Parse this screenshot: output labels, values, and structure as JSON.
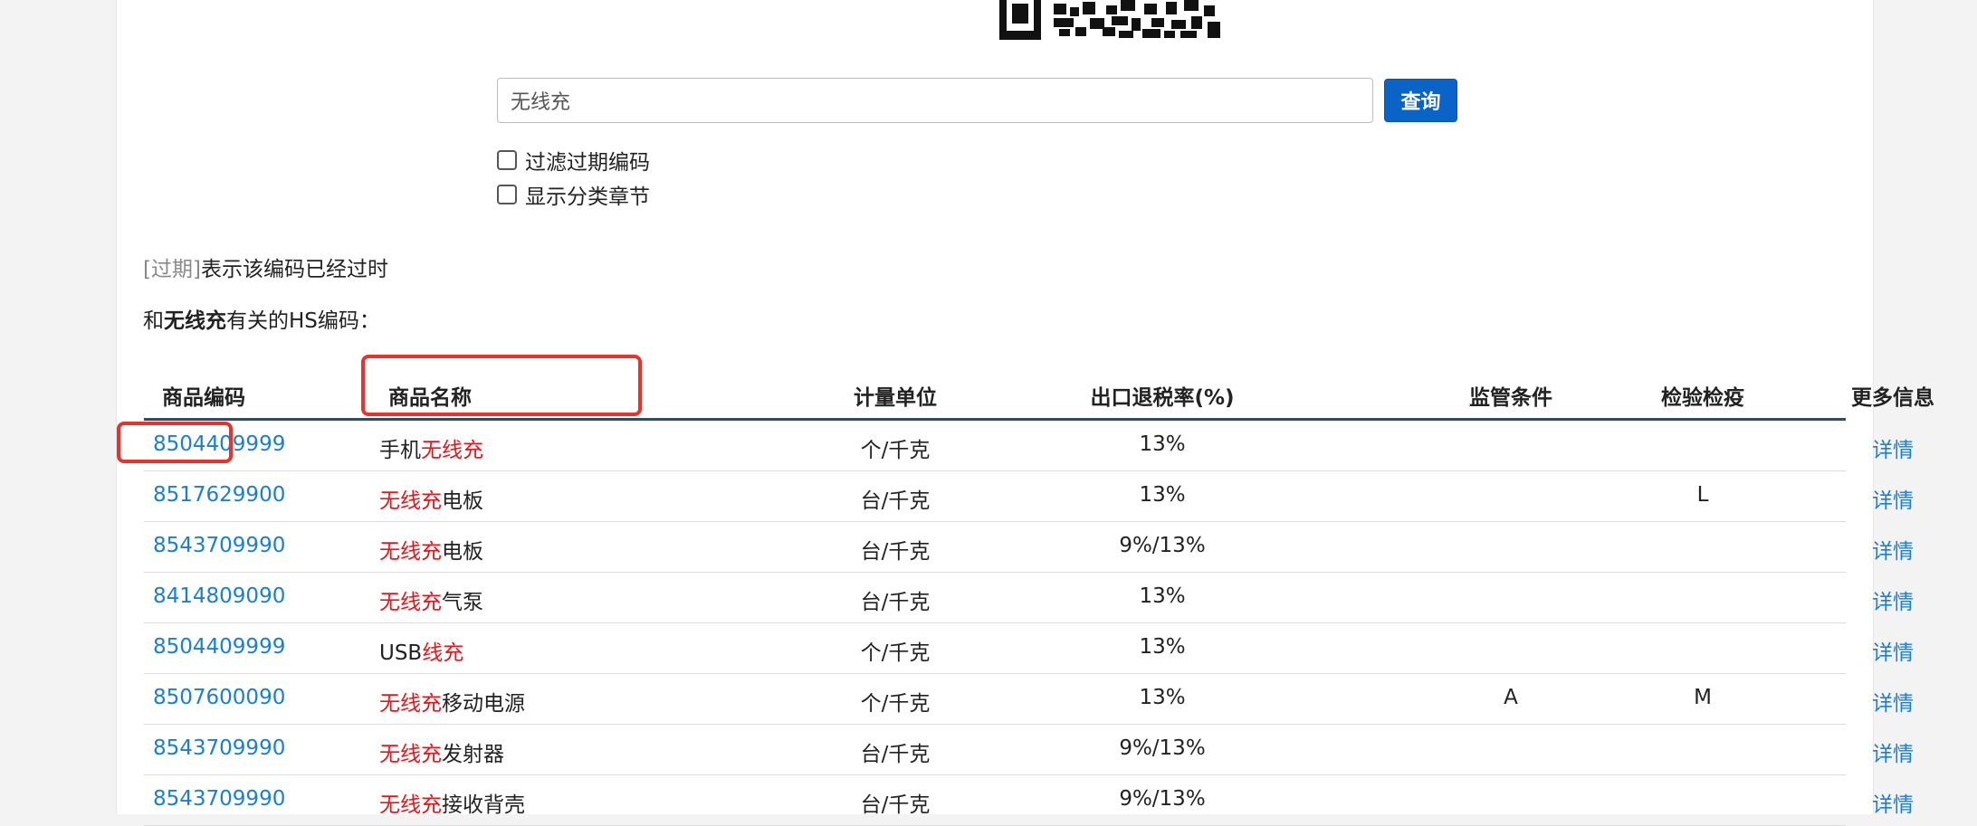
{
  "search": {
    "value": "无线充",
    "button_label": "查询"
  },
  "options": {
    "filter_expired_label": "过滤过期编码",
    "show_chapters_label": "显示分类章节"
  },
  "note": {
    "tag": "[过期]",
    "text": "表示该编码已经过时"
  },
  "heading": {
    "prefix": "和",
    "keyword": "无线充",
    "suffix": "有关的HS编码："
  },
  "table": {
    "headers": {
      "code": "商品编码",
      "name": "商品名称",
      "unit": "计量单位",
      "rate": "出口退税率(%)",
      "supervision": "监管条件",
      "inspection": "检验检疫",
      "more": "更多信息"
    },
    "rows": [
      {
        "code": "8504409999",
        "name_pre": "手机",
        "name_hl": "无线充",
        "name_post": "",
        "unit": "个/千克",
        "rate": "13%",
        "supervision": "",
        "inspection": "",
        "more": "详情"
      },
      {
        "code": "8517629900",
        "name_pre": "",
        "name_hl": "无线充",
        "name_post": "电板",
        "unit": "台/千克",
        "rate": "13%",
        "supervision": "",
        "inspection": "L",
        "more": "详情"
      },
      {
        "code": "8543709990",
        "name_pre": "",
        "name_hl": "无线充",
        "name_post": "电板",
        "unit": "台/千克",
        "rate": "9%/13%",
        "supervision": "",
        "inspection": "",
        "more": "详情"
      },
      {
        "code": "8414809090",
        "name_pre": "",
        "name_hl": "无线充",
        "name_post": "气泵",
        "unit": "台/千克",
        "rate": "13%",
        "supervision": "",
        "inspection": "",
        "more": "详情"
      },
      {
        "code": "8504409999",
        "name_pre": "USB",
        "name_hl": "线充",
        "name_post": "",
        "unit": "个/千克",
        "rate": "13%",
        "supervision": "",
        "inspection": "",
        "more": "详情"
      },
      {
        "code": "8507600090",
        "name_pre": "",
        "name_hl": "无线充",
        "name_post": "移动电源",
        "unit": "个/千克",
        "rate": "13%",
        "supervision": "A",
        "inspection": "M",
        "more": "详情"
      },
      {
        "code": "8543709990",
        "name_pre": "",
        "name_hl": "无线充",
        "name_post": "发射器",
        "unit": "台/千克",
        "rate": "9%/13%",
        "supervision": "",
        "inspection": "",
        "more": "详情"
      },
      {
        "code": "8543709990",
        "name_pre": "",
        "name_hl": "无线充",
        "name_post": "接收背壳",
        "unit": "台/千克",
        "rate": "9%/13%",
        "supervision": "",
        "inspection": "",
        "more": "详情"
      }
    ]
  },
  "colors": {
    "accent": "#0a64c8",
    "link": "#1a7fd0",
    "highlight": "#e8141b",
    "annotation": "#e8322b"
  }
}
